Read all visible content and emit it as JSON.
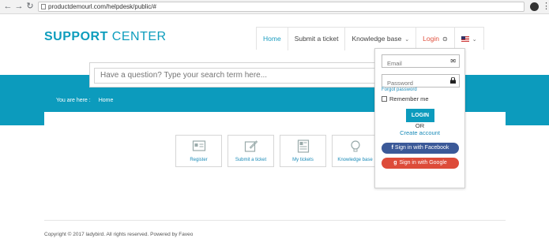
{
  "browser": {
    "url": "productdemourl.com/helpdesk/public/#"
  },
  "logo": {
    "bold": "SUPPORT",
    "rest": " CENTER"
  },
  "nav": {
    "home": "Home",
    "submit": "Submit a ticket",
    "kb": "Knowledge base",
    "login": "Login"
  },
  "search": {
    "placeholder": "Have a question? Type your search term here..."
  },
  "breadcrumb": {
    "label": "You are here :",
    "home": "Home"
  },
  "tiles": [
    {
      "label": "Register",
      "icon": "register-icon"
    },
    {
      "label": "Submit a ticket",
      "icon": "edit-icon"
    },
    {
      "label": "My tickets",
      "icon": "newspaper-icon"
    },
    {
      "label": "Knowledge base",
      "icon": "lightbulb-icon"
    }
  ],
  "login_form": {
    "email_placeholder": "Email",
    "password_placeholder": "Password",
    "forgot": "Forgot password",
    "remember": "Remember me",
    "submit": "LOGIN",
    "or": "OR",
    "create": "Create account",
    "facebook": "Sign in with Facebook",
    "google": "Sign in with Google"
  },
  "footer": {
    "text": "Copyright © 2017 ladybird. All rights reserved. Powered by Faveo"
  },
  "colors": {
    "accent": "#0c9bbd",
    "login": "#e04f3c",
    "facebook": "#3b5998",
    "google": "#dd4b39"
  }
}
